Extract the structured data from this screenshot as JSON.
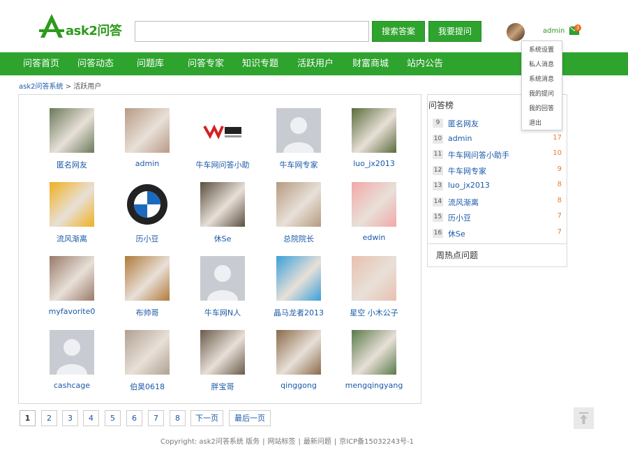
{
  "header": {
    "logo_text": "ask2问答",
    "search": {
      "placeholder": "",
      "value": ""
    },
    "search_button": "搜索答案",
    "ask_button": "我要提问",
    "username": "admin",
    "message_count": "3"
  },
  "nav": {
    "items": [
      {
        "label": "问答首页"
      },
      {
        "label": "问答动态"
      },
      {
        "label": "问题库"
      },
      {
        "label": "问答专家"
      },
      {
        "label": "知识专题"
      },
      {
        "label": "活跃用户"
      },
      {
        "label": "财富商城"
      },
      {
        "label": "站内公告"
      }
    ]
  },
  "user_menu": {
    "items": [
      {
        "label": "系统设置"
      },
      {
        "label": "私人消息"
      },
      {
        "label": "系统消息"
      },
      {
        "label": "我的提问"
      },
      {
        "label": "我的回答"
      },
      {
        "label": "退出"
      }
    ]
  },
  "breadcrumb": {
    "home": "ask2问答系统",
    "separator": ">",
    "current": "活跃用户"
  },
  "users": [
    {
      "name": "匿名网友",
      "avatar": "photo-child",
      "color": "#6a7a5a"
    },
    {
      "name": "admin",
      "avatar": "photo-woman",
      "color": "#b89a86"
    },
    {
      "name": "牛车网问答小助",
      "avatar": "logo-niuchewang",
      "color": "#d42020"
    },
    {
      "name": "牛车网专家",
      "avatar": "default-avatar",
      "color": "#c8ccd2"
    },
    {
      "name": "luo_jx2013",
      "avatar": "photo-soldier",
      "color": "#5b6b3b"
    },
    {
      "name": "流风渐离",
      "avatar": "cartoon-figure",
      "color": "#f0b020"
    },
    {
      "name": "历小豆",
      "avatar": "logo-bmw",
      "color": "#1a6ac0"
    },
    {
      "name": "休Se",
      "avatar": "photo-man",
      "color": "#5a4e3e"
    },
    {
      "name": "总院院长",
      "avatar": "photo-baby",
      "color": "#b59a80"
    },
    {
      "name": "edwin",
      "avatar": "cartoon-girl",
      "color": "#f2a8a8"
    },
    {
      "name": "myfavorite0",
      "avatar": "photo-young-man",
      "color": "#9a7a6a"
    },
    {
      "name": "布帅哥",
      "avatar": "photo-kangaroo",
      "color": "#b07a3a"
    },
    {
      "name": "牛车网N人",
      "avatar": "default-avatar",
      "color": "#c8ccd2"
    },
    {
      "name": "晶马龙者2013",
      "avatar": "photo-beach",
      "color": "#3aa0d8"
    },
    {
      "name": "星空 小木公子",
      "avatar": "photo-girl",
      "color": "#e8c0b0"
    },
    {
      "name": "cashcage",
      "avatar": "default-avatar",
      "color": "#c8ccd2"
    },
    {
      "name": "伯昊0618",
      "avatar": "photo-map",
      "color": "#b0a090"
    },
    {
      "name": "胖宝哥",
      "avatar": "photo-blur",
      "color": "#6a5a4a"
    },
    {
      "name": "qinggong",
      "avatar": "photo-actor",
      "color": "#8a6a4a"
    },
    {
      "name": "mengqingyang",
      "avatar": "photo-hiker",
      "color": "#5a7a4a"
    }
  ],
  "ranking": {
    "title": "问答榜",
    "rows": [
      {
        "rank": "9",
        "name": "匿名网友",
        "score": ""
      },
      {
        "rank": "10",
        "name": "admin",
        "score": "17"
      },
      {
        "rank": "11",
        "name": "牛车网问答小助手",
        "score": "10"
      },
      {
        "rank": "12",
        "name": "牛车网专家",
        "score": "9"
      },
      {
        "rank": "13",
        "name": "luo_jx2013",
        "score": "8"
      },
      {
        "rank": "14",
        "name": "流风渐离",
        "score": "8"
      },
      {
        "rank": "15",
        "name": "历小豆",
        "score": "7"
      },
      {
        "rank": "16",
        "name": "休Se",
        "score": "7"
      }
    ],
    "hot_title": "周热点问题"
  },
  "pagination": {
    "pages": [
      "1",
      "2",
      "3",
      "4",
      "5",
      "6",
      "7",
      "8"
    ],
    "current": "1",
    "next": "下一页",
    "last": "最后一页"
  },
  "footer": {
    "copyright": "Copyright: ask2问答系统 版务",
    "sitemap": "网站标签",
    "latest": "最新问题",
    "icp": "京ICP备15032243号-1"
  },
  "colors": {
    "brand_green": "#2ea32d",
    "link_blue": "#1a58a8",
    "score_orange": "#f07a2a"
  }
}
